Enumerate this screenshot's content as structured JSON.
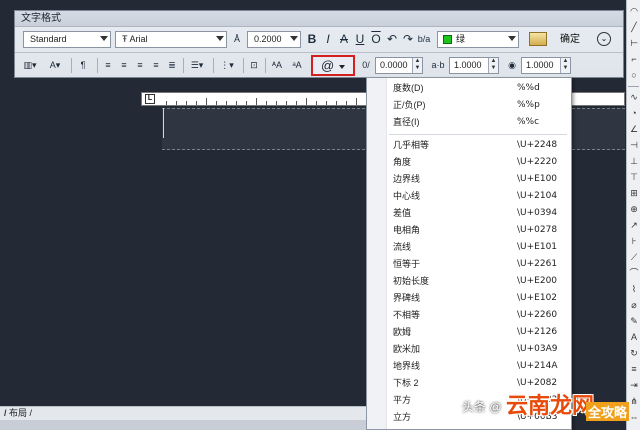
{
  "window": {
    "title": "文字格式"
  },
  "toolbar1": {
    "style": "Standard",
    "font": "Arial",
    "height": "0.2000",
    "bold": "B",
    "italic": "I",
    "strike": "A",
    "underline": "U",
    "overline": "O",
    "color": "绿",
    "ok": "确定"
  },
  "toolbar2": {
    "symbol": "@",
    "oblique": "0.0000",
    "tracking": "1.0000",
    "width_factor": "1.0000"
  },
  "symbol_menu": {
    "items": [
      {
        "label": "度数(D)",
        "code": "%%d"
      },
      {
        "label": "正/负(P)",
        "code": "%%p"
      },
      {
        "label": "直径(I)",
        "code": "%%c"
      },
      {
        "label": "几乎相等",
        "code": "\\U+2248"
      },
      {
        "label": "角度",
        "code": "\\U+2220"
      },
      {
        "label": "边界线",
        "code": "\\U+E100"
      },
      {
        "label": "中心线",
        "code": "\\U+2104"
      },
      {
        "label": "差值",
        "code": "\\U+0394"
      },
      {
        "label": "电相角",
        "code": "\\U+0278"
      },
      {
        "label": "流线",
        "code": "\\U+E101"
      },
      {
        "label": "恒等于",
        "code": "\\U+2261"
      },
      {
        "label": "初始长度",
        "code": "\\U+E200"
      },
      {
        "label": "界碑线",
        "code": "\\U+E102"
      },
      {
        "label": "不相等",
        "code": "\\U+2260"
      },
      {
        "label": "欧姆",
        "code": "\\U+2126"
      },
      {
        "label": "欧米加",
        "code": "\\U+03A9"
      },
      {
        "label": "地界线",
        "code": "\\U+214A"
      },
      {
        "label": "下标 2",
        "code": "\\U+2082"
      },
      {
        "label": "平方",
        "code": "\\U+00B2"
      },
      {
        "label": "立方",
        "code": "\\U+00B3"
      }
    ]
  },
  "bottom_tab": {
    "label": "布局"
  },
  "watermark": {
    "source": "头条 @",
    "brand": "云南龙网",
    "tag": "全攻略"
  }
}
